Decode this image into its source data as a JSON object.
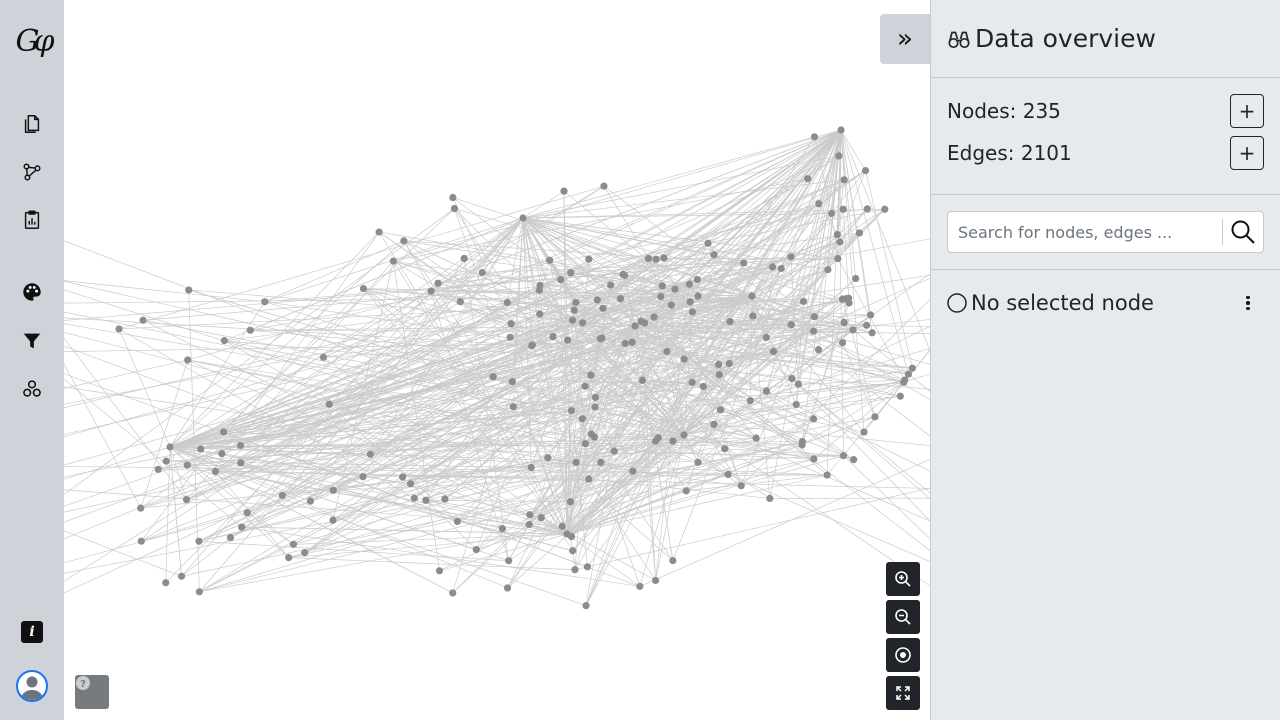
{
  "app": {
    "logo_text": "Gφ"
  },
  "sidebar": {
    "buttons": [
      {
        "name": "file-icon",
        "tooltip": "File"
      },
      {
        "name": "graph-icon",
        "tooltip": "Graph"
      },
      {
        "name": "clipboard-icon",
        "tooltip": "Statistics"
      },
      {
        "name": "palette-icon",
        "tooltip": "Appearance"
      },
      {
        "name": "filter-icon",
        "tooltip": "Filters"
      },
      {
        "name": "layout-icon",
        "tooltip": "Layout"
      }
    ],
    "info_label": "i"
  },
  "graph": {
    "node_color": "#8c8c8c",
    "edge_color": "#cbcbcb",
    "controls": [
      "zoom-in-icon",
      "zoom-out-icon",
      "center-icon",
      "fullscreen-icon"
    ]
  },
  "collapse_toggle": "»",
  "panel": {
    "title": "Data overview",
    "nodes_label": "Nodes: 235",
    "edges_label": "Edges: 2101",
    "add_symbol": "+",
    "search": {
      "placeholder": "Search for nodes, edges ..."
    },
    "selection": {
      "label": "No selected node"
    }
  },
  "colors": {
    "sidebar_bg": "#ced3da",
    "panel_bg": "#e7eaed",
    "accent": "#1a73e8",
    "dark_button": "#212529"
  }
}
